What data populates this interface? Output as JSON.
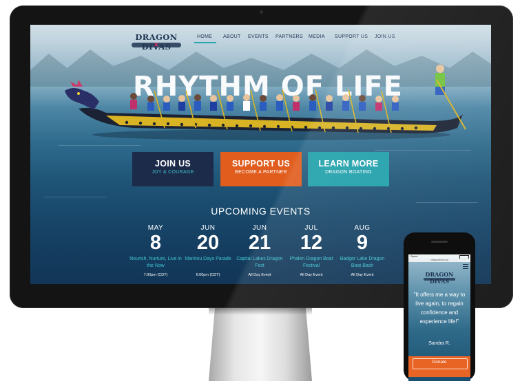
{
  "site": {
    "logo_text": "DRAGON DIVAS",
    "nav": [
      "HOME",
      "ABOUT",
      "EVENTS",
      "PARTNERS",
      "MEDIA",
      "SUPPORT US",
      "JOIN US"
    ],
    "hero_title": "RHYTHM OF LIFE",
    "buttons": [
      {
        "title": "JOIN US",
        "subtitle": "JOY & COURAGE",
        "color": "#1c2b4a",
        "sub_color": "#3fc3cf"
      },
      {
        "title": "SUPPORT US",
        "subtitle": "BECOME A PARTNER",
        "color": "#e05d1e",
        "sub_color": "#ffffff"
      },
      {
        "title": "LEARN MORE",
        "subtitle": "DRAGON BOATING",
        "color": "#1fa0aa",
        "sub_color": "#ffffff"
      }
    ],
    "events_heading": "UPCOMING EVENTS",
    "events": [
      {
        "month": "MAY",
        "day": "8",
        "name": "Nourish, Nurture, Live in the Now",
        "time": "7:00pm (CDT)"
      },
      {
        "month": "JUN",
        "day": "20",
        "name": "Manitou Days Parade",
        "time": "6:00pm (CDT)"
      },
      {
        "month": "JUN",
        "day": "21",
        "name": "Capital Lakes Dragon Fest",
        "time": "All Day Event"
      },
      {
        "month": "JUL",
        "day": "12",
        "name": "Phalen Dragon Boat Festival",
        "time": "All Day Event"
      },
      {
        "month": "AUG",
        "day": "9",
        "name": "Badger Lake Dragon Boat Bash",
        "time": "All Day Event"
      }
    ]
  },
  "phone": {
    "carrier": "Sprint",
    "url": "dragondivas.org",
    "logo_text": "DRAGON DIVAS",
    "quote": "\"It offers me a way to live again, to regain confidence and experience life!\"",
    "author": "Sandra R.",
    "donate_label": "Donate",
    "menu_icon": "hamburger-icon"
  },
  "colors": {
    "accent_teal": "#2aa7b0",
    "navy": "#1e3552",
    "orange": "#e05d1e"
  }
}
